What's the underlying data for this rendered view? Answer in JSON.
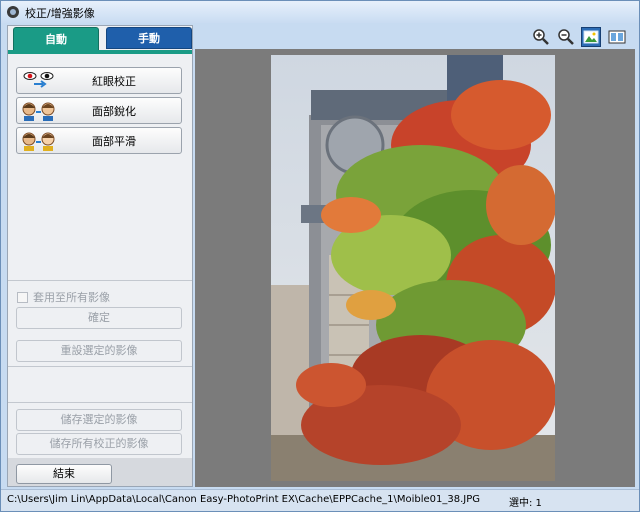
{
  "window": {
    "title": "校正/增強影像"
  },
  "tabs": [
    {
      "label": "自動"
    },
    {
      "label": "手動"
    }
  ],
  "auto_buttons": [
    {
      "label": "紅眼校正",
      "icon": "red-eye-icon"
    },
    {
      "label": "面部銳化",
      "icon": "face-sharpen-icon"
    },
    {
      "label": "面部平滑",
      "icon": "face-smooth-icon"
    }
  ],
  "apply_all": {
    "label": "套用至所有影像",
    "checked": false
  },
  "ok_label": "確定",
  "reset_label": "重設選定的影像",
  "save_selected_label": "儲存選定的影像",
  "save_all_label": "儲存所有校正的影像",
  "exit_label": "結束",
  "toolbar": {
    "zoom_in_icon": "zoom-in-icon",
    "zoom_out_icon": "zoom-out-icon",
    "view_whole_icon": "whole-image-icon",
    "compare_icon": "compare-view-icon"
  },
  "status": {
    "path": "C:\\Users\\Jim Lin\\AppData\\Local\\Canon Easy-PhotoPrint EX\\Cache\\EPPCache_1\\Moible01_38.JPG",
    "selected": "選中: 1"
  }
}
